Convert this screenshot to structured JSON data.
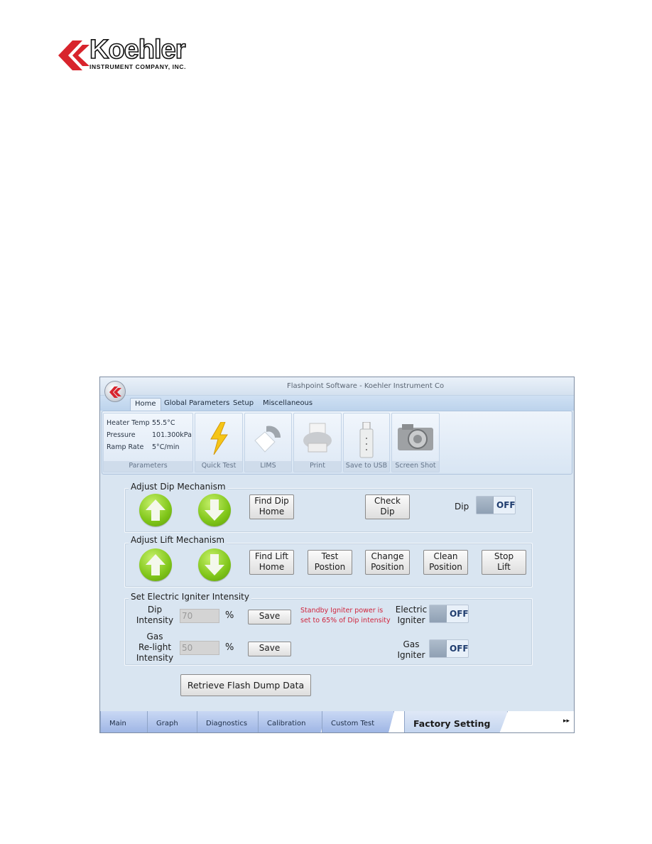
{
  "logo": {
    "brand": "Koehler",
    "subtitle": "INSTRUMENT COMPANY, INC."
  },
  "window": {
    "title": "Flashpoint Software - Koehler Instrument Co"
  },
  "ribbon_tabs": [
    {
      "label": "Home",
      "active": true
    },
    {
      "label": "Global Parameters",
      "active": false
    },
    {
      "label": "Setup",
      "active": false
    },
    {
      "label": "Miscellaneous",
      "active": false
    }
  ],
  "parameters": {
    "group_label": "Parameters",
    "rows": [
      {
        "label": "Heater Temp",
        "value": "55.5°C"
      },
      {
        "label": "Pressure",
        "value": "101.300kPa"
      },
      {
        "label": "Ramp Rate",
        "value": "5°C/min"
      }
    ]
  },
  "ribbon_groups": [
    {
      "label": "Quick Test",
      "icon": "lightning-icon"
    },
    {
      "label": "LIMS",
      "icon": "lims-icon"
    },
    {
      "label": "Print",
      "icon": "printer-icon"
    },
    {
      "label": "Save to USB",
      "icon": "usb-drive-icon"
    },
    {
      "label": "Screen Shot",
      "icon": "camera-icon"
    }
  ],
  "dip": {
    "legend": "Adjust Dip Mechanism",
    "find_home": [
      "Find Dip",
      "Home"
    ],
    "check_dip": [
      "Check",
      "Dip"
    ],
    "toggle_label": "Dip",
    "toggle_state": "OFF"
  },
  "lift": {
    "legend": "Adjust Lift Mechanism",
    "buttons": [
      [
        "Find Lift",
        "Home"
      ],
      [
        "Test",
        "Postion"
      ],
      [
        "Change",
        "Position"
      ],
      [
        "Clean",
        "Position"
      ],
      [
        "Stop",
        "Lift"
      ]
    ]
  },
  "igniter": {
    "legend": "Set Electric Igniter Intensity",
    "dip_label": [
      "Dip",
      "Intensity"
    ],
    "dip_value": "70",
    "gas_label": [
      "Gas",
      "Re-light",
      "Intensity"
    ],
    "gas_value": "50",
    "percent": "%",
    "save_label": "Save",
    "note": [
      "Standby Igniter power is",
      "set to 65% of Dip intensity"
    ],
    "electric_label": [
      "Electric",
      "Igniter"
    ],
    "electric_state": "OFF",
    "gas_igniter_label": [
      "Gas",
      "Igniter"
    ],
    "gas_igniter_state": "OFF"
  },
  "retrieve_label": "Retrieve Flash Dump Data",
  "bottom_tabs": [
    {
      "label": "Main",
      "active": false
    },
    {
      "label": "Graph",
      "active": false
    },
    {
      "label": "Diagnostics",
      "active": false
    },
    {
      "label": "Calibration",
      "active": false
    },
    {
      "label": "Custom Test",
      "active": false
    },
    {
      "label": "Factory Setting",
      "active": true
    }
  ],
  "more_tabs_glyph": "▸▸"
}
